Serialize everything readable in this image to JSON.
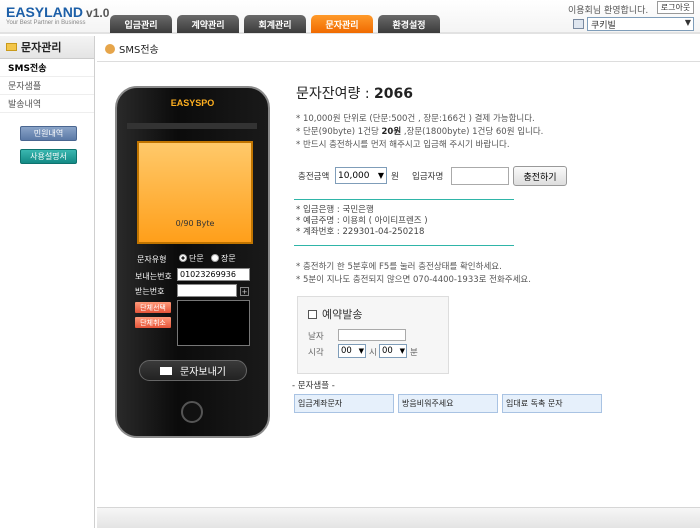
{
  "header": {
    "brand": "EASYLAND",
    "version": "v1.0",
    "slogan": "Your Best Partner in Business",
    "tabs": [
      "입금관리",
      "계약관리",
      "회계관리",
      "문자관리",
      "환경설정"
    ],
    "active_tab": "문자관리",
    "greeting": "이용회님 환영합니다.",
    "logout_label": "로그아웃",
    "site_select": "쿠키빌"
  },
  "sidebar": {
    "title": "문자관리",
    "items": [
      {
        "label": "SMS전송",
        "active": true
      },
      {
        "label": "문자샘플",
        "active": false
      },
      {
        "label": "발송내역",
        "active": false
      }
    ],
    "inquiry_label": "민원내역",
    "manual_label": "사용설명서"
  },
  "content": {
    "title": "SMS전송",
    "phone": {
      "brand": "EASYSPO",
      "byte_count": "0/90 Byte",
      "msg_type_label": "문자유형",
      "type_short": "단문",
      "type_long": "장문",
      "selected_type": "단문",
      "receiver_label": "보내는번호",
      "receiver_value": "01023269936",
      "sender_label": "받는번호",
      "sender_value": "",
      "plus_label": "+",
      "group_select_label": "단체선택",
      "group_cancel_label": "단체취소",
      "send_label": "문자보내기"
    },
    "balance_label": "문자잔여량 :",
    "balance_value": "2066",
    "notes": [
      "* 10,000원 단위로 (단문:500건 , 장문:166건 ) 결제 가능합니다.",
      "* 단문(90byte) 1건당 ",
      "20원",
      " ,장문(1800byte) 1건당 60원 입니다.",
      "* 반드시 충전하시를 먼저 해주시고 입금해 주시기 바랍니다."
    ],
    "charge_label": "충전금액",
    "charge_value": "10,000",
    "charge_unit": "원",
    "depositor_label": "입금자명",
    "depositor_value": "",
    "charge_button": "충전하기",
    "bank": {
      "bank_line": "* 입금은행 : 국민은행",
      "holder_line": "* 예금주명 : 이용희 ( 아이티프렌즈 )",
      "account_line": "* 계좌번호 : 229301-04-250218"
    },
    "notice2": [
      "* 충전하기 한 5분후에 F5를 눌러 충전상태를 확인하세요.",
      "* 5분이 지나도 충전되지 않으면 070-4400-1933로 전화주세요."
    ],
    "reservation": {
      "title": "예약발송",
      "date_label": "날자",
      "time_label": "시각",
      "hour_value": "00",
      "hour_unit": "시",
      "minute_value": "00",
      "minute_unit": "분"
    },
    "templates_title": "- 문자샘플 -",
    "templates": [
      "입금계좌문자",
      "방음비워주세요",
      "임대료 독촉 문자"
    ]
  },
  "colors": {
    "brand_blue": "#1c5fa8",
    "tab_active": "#f07a0a",
    "tab_inactive": "#4a4a4a",
    "teal_line": "#2fb5a8",
    "phone_screen": "#ffab30",
    "template_bg": "#e6f0fb"
  },
  "icons": [
    "folder-icon",
    "user-group-icon",
    "envelope-icon",
    "favorites-icon",
    "chevron-down-icon"
  ]
}
